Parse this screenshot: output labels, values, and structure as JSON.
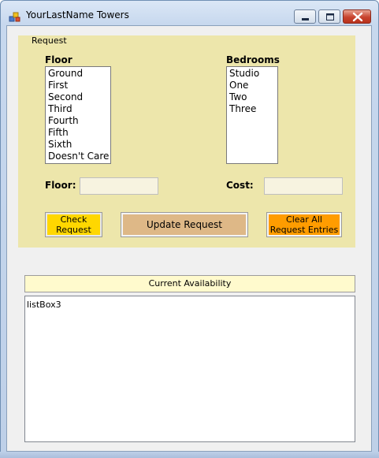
{
  "window": {
    "title": "YourLastName Towers"
  },
  "request_group": {
    "legend": "Request",
    "floor_label": "Floor",
    "floors": [
      "Ground",
      "First",
      "Second",
      "Third",
      "Fourth",
      "Fifth",
      "Sixth",
      "Doesn't Care"
    ],
    "bedrooms_label": "Bedrooms",
    "bedrooms": [
      "Studio",
      "One",
      "Two",
      "Three"
    ],
    "floor_field_label": "Floor:",
    "floor_field_value": "",
    "cost_field_label": "Cost:",
    "cost_field_value": "",
    "buttons": {
      "check": "Check Request",
      "update": "Update Request",
      "clear": "Clear All Request Entries"
    }
  },
  "availability": {
    "header": "Current Availability",
    "list_placeholder": "listBox3"
  },
  "colors": {
    "group_background": "#ede6ab",
    "check_button": "#ffd700",
    "update_button": "#deb887",
    "clear_button": "#ff9c00",
    "availability_header": "#fffacd"
  }
}
